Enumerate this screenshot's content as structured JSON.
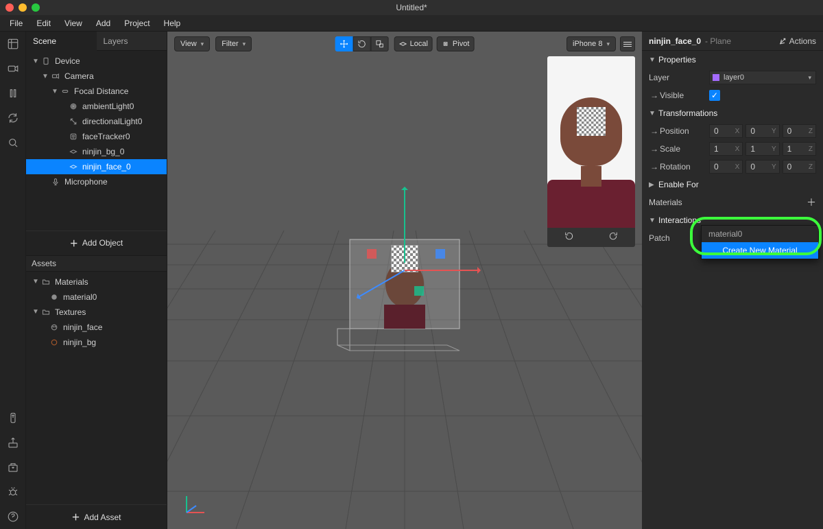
{
  "window": {
    "title": "Untitled*"
  },
  "menubar": [
    "File",
    "Edit",
    "View",
    "Add",
    "Project",
    "Help"
  ],
  "leftTabs": {
    "scene": "Scene",
    "layers": "Layers"
  },
  "sceneTree": {
    "device": "Device",
    "camera": "Camera",
    "focal": "Focal Distance",
    "ambient": "ambientLight0",
    "directional": "directionalLight0",
    "faceTracker": "faceTracker0",
    "ninjinBg": "ninjin_bg_0",
    "ninjinFace": "ninjin_face_0",
    "mic": "Microphone"
  },
  "addObject": "Add Object",
  "assets": {
    "header": "Assets",
    "materials": "Materials",
    "material0": "material0",
    "textures": "Textures",
    "ninjinFace": "ninjin_face",
    "ninjinBg": "ninjin_bg"
  },
  "addAsset": "Add Asset",
  "viewportToolbar": {
    "view": "View",
    "filter": "Filter",
    "local": "Local",
    "pivot": "Pivot",
    "device": "iPhone 8"
  },
  "inspector": {
    "nodeName": "ninjin_face_0",
    "nodeType": "- Plane",
    "actions": "Actions",
    "properties": "Properties",
    "layerLabel": "Layer",
    "layerName": "layer0",
    "visible": "Visible",
    "transformations": "Transformations",
    "position": "Position",
    "scale": "Scale",
    "rotation": "Rotation",
    "posVals": {
      "x": "0",
      "y": "0",
      "z": "0"
    },
    "scaleVals": {
      "x": "1",
      "y": "1",
      "z": "1"
    },
    "rotVals": {
      "x": "0",
      "y": "0",
      "z": "0"
    },
    "enableFor": "Enable For",
    "materials": "Materials",
    "interactions": "Interactions",
    "patch": "Patch",
    "menuMaterial0": "material0",
    "menuCreate": "Create New Material"
  }
}
